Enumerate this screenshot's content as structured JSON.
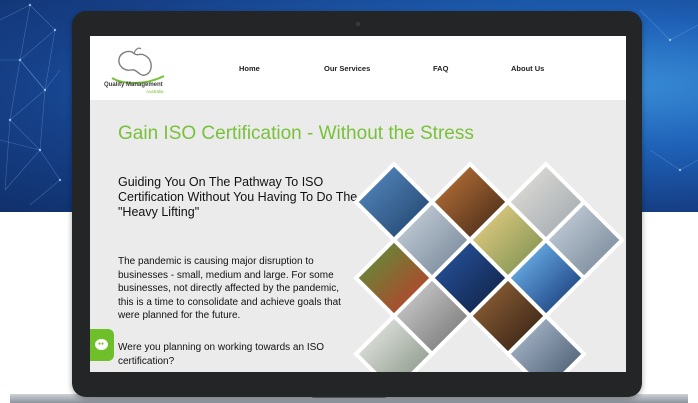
{
  "logo": {
    "name": "Quality Management",
    "sub": "Australia"
  },
  "nav": {
    "items": [
      {
        "label": "Home"
      },
      {
        "label": "Our Services"
      },
      {
        "label": "FAQ"
      },
      {
        "label": "About Us"
      }
    ]
  },
  "hero": {
    "title": "Gain ISO Certification - Without the Stress",
    "subhead": "Guiding You On The Pathway To ISO Certification Without You Having To Do The \"Heavy Lifting\"",
    "paragraph": "The pandemic is causing major disruption to businesses - small, medium and large. For some businesses, not directly affected by the pandemic, this is a time to consolidate and achieve goals that were planned for the future.",
    "question": "Were you planning on working towards an ISO certification?"
  },
  "colors": {
    "accent": "#79c13a",
    "chat": "#6fbf2a",
    "bezel": "#232527"
  },
  "icons": {
    "chat": "chat-bubble-icon",
    "camera": "camera-icon"
  }
}
